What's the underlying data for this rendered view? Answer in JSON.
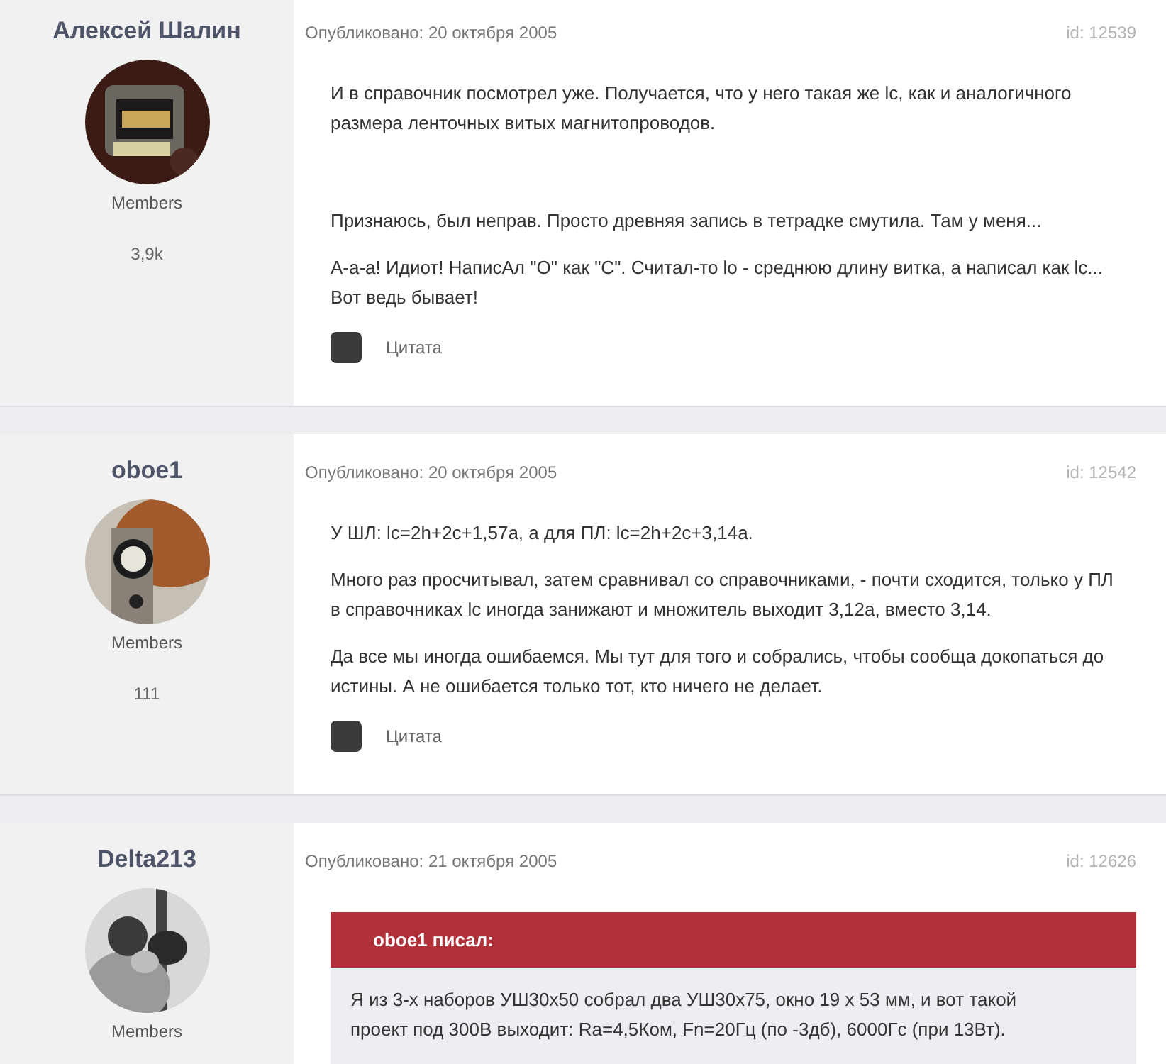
{
  "posts": [
    {
      "author": "Алексей Шалин",
      "group": "Members",
      "count": "3,9k",
      "avatar": {
        "kind": "picture"
      },
      "published": "Опубликовано: 20 октября 2005",
      "id": "id: 12539",
      "blocks": [
        {
          "kind": "para",
          "text": "И в справочник посмотрел уже. Получается, что у него такая же lc, как и аналогичного размера ленточных витых магнитопроводов."
        },
        {
          "kind": "spacer"
        },
        {
          "kind": "para",
          "text": "Признаюсь, был неправ. Просто древняя запись в тетрадке смутила. Там у меня..."
        },
        {
          "kind": "para",
          "text": "А-а-а! Идиот! НаписАл \"О\" как \"С\". Считал-то lo - среднюю длину витка, а написал как lc... Вот ведь бывает!"
        }
      ],
      "quote_label": "Цитата"
    },
    {
      "author": "oboe1",
      "group": "Members",
      "count": "111",
      "avatar": {
        "kind": "picture"
      },
      "published": "Опубликовано: 20 октября 2005",
      "id": "id: 12542",
      "blocks": [
        {
          "kind": "para",
          "text": "У ШЛ: lc=2h+2c+1,57a, а для ПЛ: lc=2h+2c+3,14a."
        },
        {
          "kind": "para",
          "text": "Много раз просчитывал, затем сравнивал со справочниками, - почти сходится, только у ПЛ в справочниках lc иногда занижают и множитель выходит 3,12a, вместо 3,14."
        },
        {
          "kind": "para",
          "text": "Да все мы иногда ошибаемся. Мы тут для того и собрались, чтобы сообща докопаться до истины. А не ошибается только тот, кто ничего не делает."
        }
      ],
      "quote_label": "Цитата"
    },
    {
      "author": "Delta213",
      "group": "Members",
      "avatar": {
        "kind": "picture"
      },
      "published": "Опубликовано: 21 октября 2005",
      "id": "id: 12626",
      "blocks": [
        {
          "kind": "quote",
          "header": "oboe1 писал:",
          "text": "Я из 3-х наборов УШ30х50 собрал два УШ30х75, окно 19 х 53 мм, и вот такой проект под 300В выходит: Ra=4,5Ком, Fn=20Гц (по -3дб), 6000Гс (при 13Вт)."
        }
      ]
    }
  ]
}
